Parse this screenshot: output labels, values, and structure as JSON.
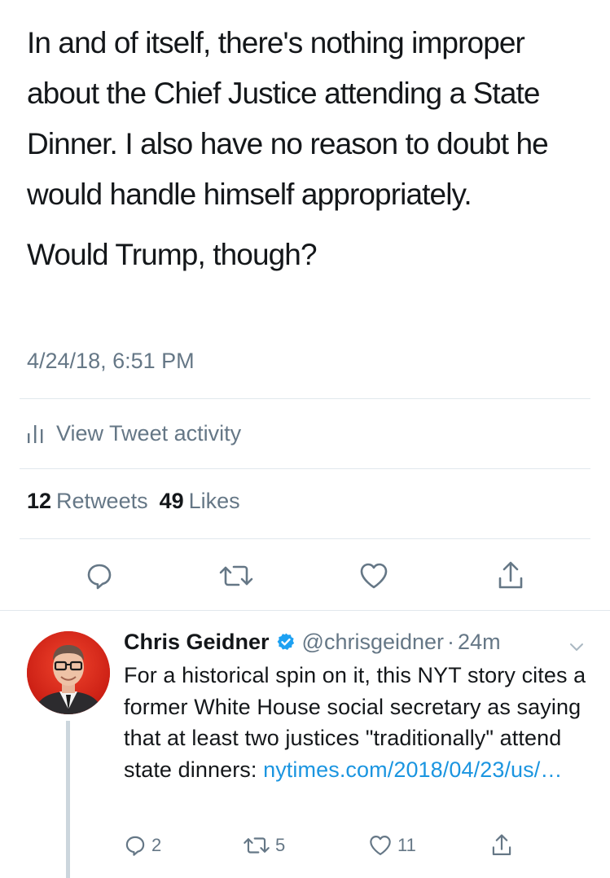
{
  "tweet": {
    "paragraphs": [
      "In and of itself, there's nothing improper about the Chief Justice attending a State Dinner. I also have no reason to doubt he would handle himself appropriately.",
      "Would Trump, though?"
    ],
    "timestamp": "4/24/18, 6:51 PM",
    "activity_label": "View Tweet activity",
    "retweets_count": "12",
    "retweets_label": "Retweets",
    "likes_count": "49",
    "likes_label": "Likes"
  },
  "icons": {
    "activity": "bar-chart-icon",
    "reply": "reply-bubble-icon",
    "retweet": "retweet-icon",
    "like": "heart-icon",
    "share": "share-icon",
    "verified": "verified-badge-icon",
    "chevron": "chevron-down-icon"
  },
  "reply": {
    "name": "Chris Geidner",
    "handle": "@chrisgeidner",
    "separator": "·",
    "time": "24m",
    "text": "For a historical spin on it, this NYT story cites a former White House social secretary as saying that at least two justices \"traditionally\" attend state dinners: ",
    "link": "nytimes.com/2018/04/23/us/…",
    "reply_count": "2",
    "retweet_count": "5",
    "like_count": "11"
  },
  "colors": {
    "text": "#14171a",
    "secondary": "#657786",
    "link": "#1b95e0",
    "divider": "#e1e8ed",
    "avatar_bg": "#e0261b"
  }
}
